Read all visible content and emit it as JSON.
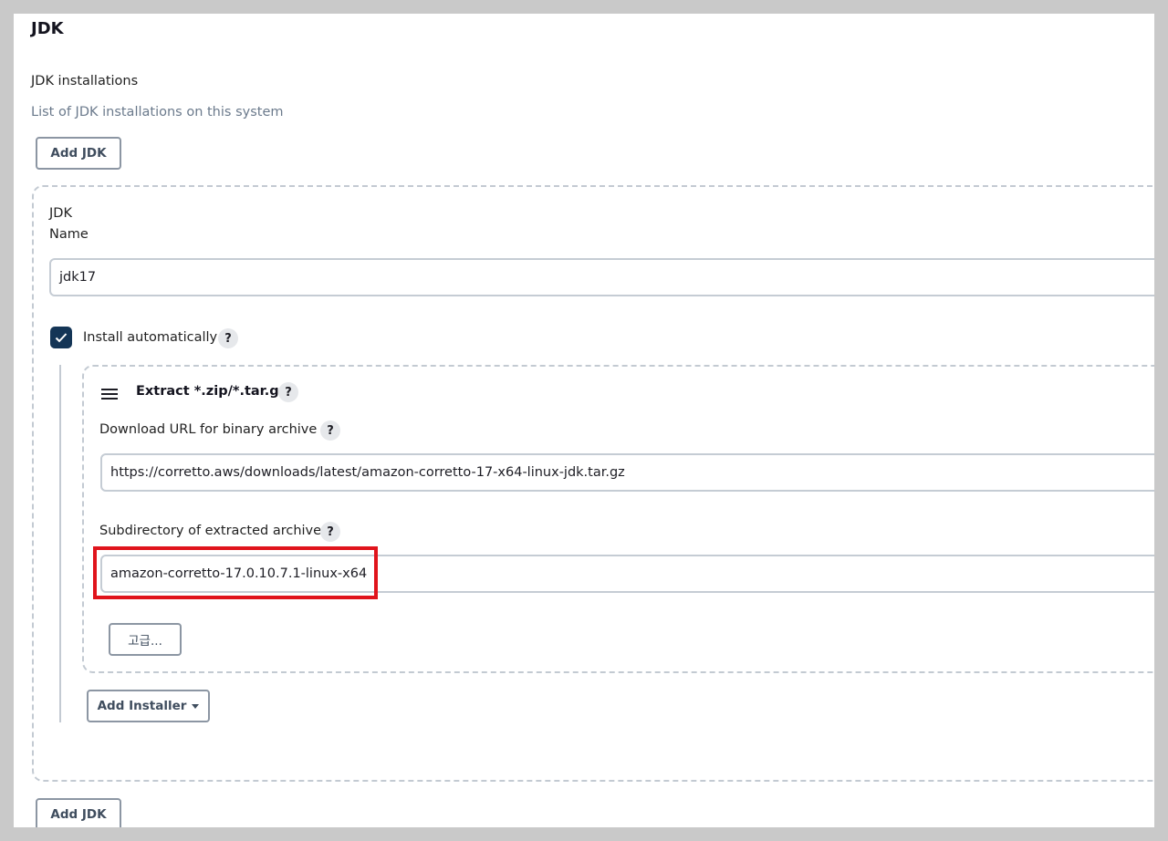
{
  "section": {
    "title": "JDK"
  },
  "jdk_installations": {
    "label": "JDK installations",
    "description": "List of JDK installations on this system",
    "add_button_label": "Add JDK"
  },
  "jdk_entry": {
    "header": "JDK",
    "name_label": "Name",
    "name_value": "jdk17",
    "install_auto_label": "Install automatically",
    "install_auto_checked": true,
    "help_glyph": "?"
  },
  "installer": {
    "title": "Extract *.zip/*.tar.gz",
    "url_label": "Download URL for binary archive",
    "url_value": "https://corretto.aws/downloads/latest/amazon-corretto-17-x64-linux-jdk.tar.gz",
    "subdir_label": "Subdirectory of extracted archive",
    "subdir_value": "amazon-corretto-17.0.10.7.1-linux-x64",
    "advanced_button_label": "고급...",
    "add_installer_label": "Add Installer"
  },
  "bottom": {
    "add_button_label": "Add JDK"
  },
  "colors": {
    "checkbox": "#143556",
    "highlight": "#e0141c",
    "description_text": "#6b7a8c"
  },
  "icons": [
    "check-icon",
    "help-icon",
    "drag-handle-icon",
    "caret-down-icon"
  ]
}
